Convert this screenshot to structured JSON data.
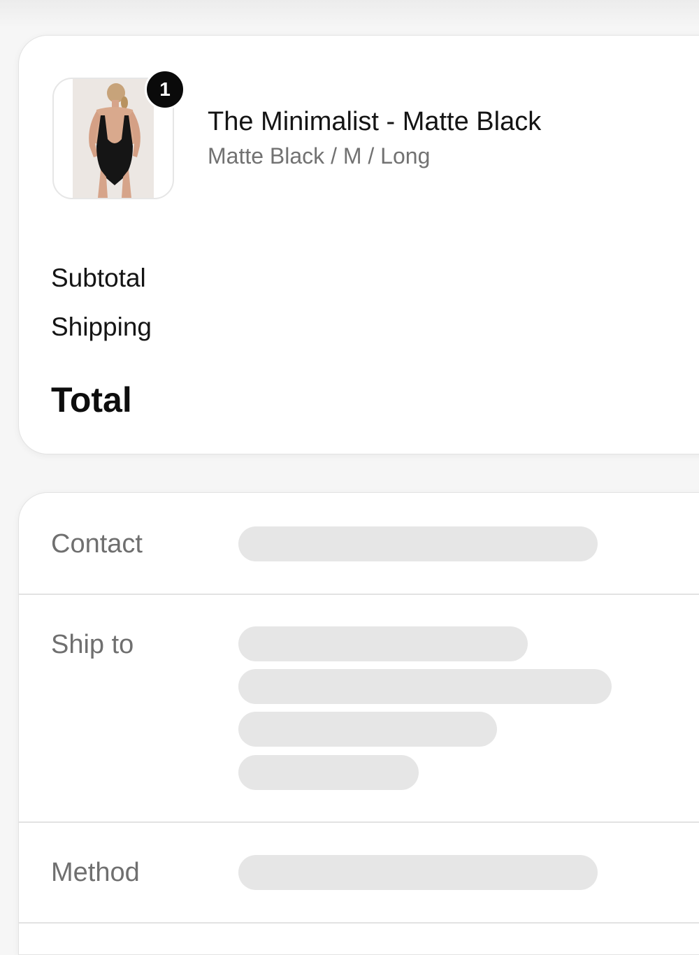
{
  "order_summary": {
    "item": {
      "quantity": "1",
      "name": "The Minimalist - Matte Black",
      "variant": "Matte Black / M / Long"
    },
    "subtotal_label": "Subtotal",
    "shipping_label": "Shipping",
    "total_label": "Total"
  },
  "details": {
    "contact_label": "Contact",
    "ship_to_label": "Ship to",
    "method_label": "Method"
  },
  "colors": {
    "page_background": "#f6f6f6",
    "card_background": "#ffffff",
    "badge_background": "#0a0a0a",
    "skeleton_placeholder": "#e6e6e6",
    "muted_text": "#727272"
  }
}
